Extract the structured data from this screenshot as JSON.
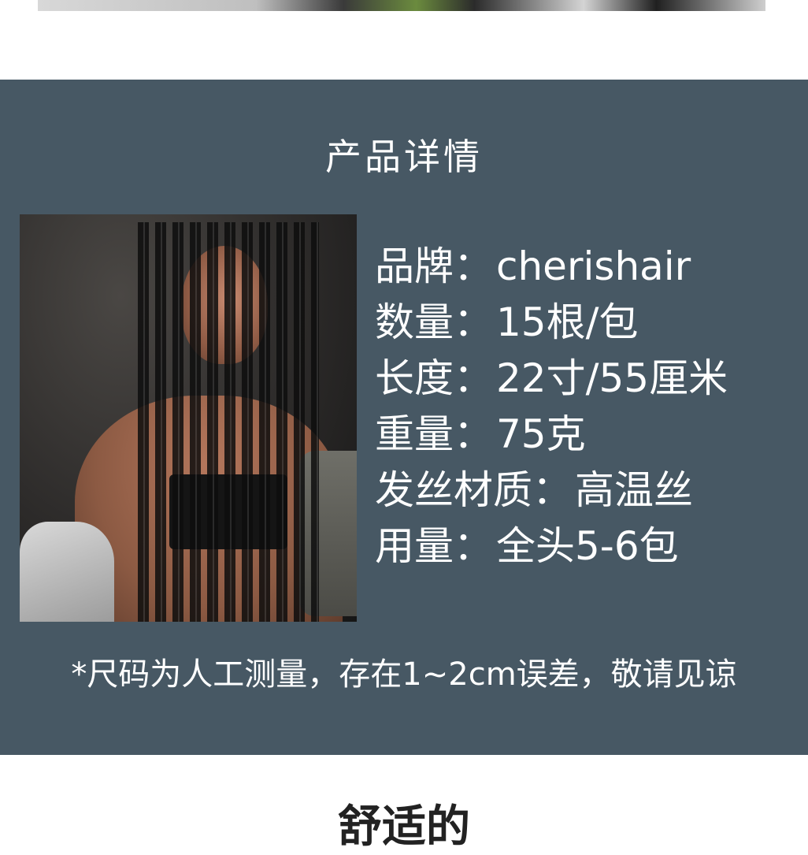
{
  "colors": {
    "panel_bg": "#475864",
    "text": "#ffffff"
  },
  "section": {
    "title": "产品详情",
    "specs": [
      {
        "label": "品牌：",
        "value": "cherishair"
      },
      {
        "label": "数量：",
        "value": "15根/包"
      },
      {
        "label": "长度：",
        "value": "22寸/55厘米"
      },
      {
        "label": "重量：",
        "value": "75克"
      },
      {
        "label": "发丝材质：",
        "value": "高温丝"
      },
      {
        "label": "用量：",
        "value": "全头5-6包"
      }
    ],
    "note": "*尺码为人工测量，存在1~2cm误差，敬请见谅"
  },
  "bottom": {
    "heading": "舒适的"
  }
}
